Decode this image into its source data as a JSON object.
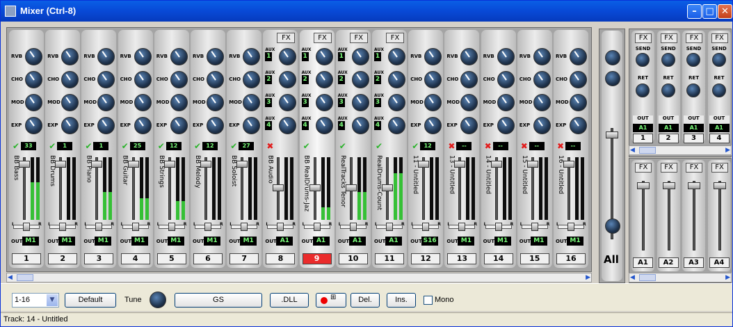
{
  "window": {
    "title": "Mixer (Ctrl-8)"
  },
  "tracks": [
    {
      "num": "1",
      "name": "BB Bass",
      "patch": "33",
      "status": "check",
      "out": "M1",
      "fx": false,
      "level": 0.6,
      "selected": false
    },
    {
      "num": "2",
      "name": "BB Drums",
      "patch": "1",
      "status": "check",
      "out": "M1",
      "fx": false,
      "level": 0,
      "selected": false
    },
    {
      "num": "3",
      "name": "BB Piano",
      "patch": "1",
      "status": "check",
      "out": "M1",
      "fx": false,
      "level": 0.45,
      "selected": false
    },
    {
      "num": "4",
      "name": "BB Guitar",
      "patch": "25",
      "status": "check",
      "out": "M1",
      "fx": false,
      "level": 0.35,
      "selected": false
    },
    {
      "num": "5",
      "name": "BB Strings",
      "patch": "12",
      "status": "check",
      "out": "M1",
      "fx": false,
      "level": 0.3,
      "selected": false
    },
    {
      "num": "6",
      "name": "BB Melody",
      "patch": "12",
      "status": "check",
      "out": "M1",
      "fx": false,
      "level": 0,
      "selected": false
    },
    {
      "num": "7",
      "name": "BB Soloist",
      "patch": "27",
      "status": "check",
      "out": "M1",
      "fx": false,
      "level": 0,
      "selected": false
    },
    {
      "num": "8",
      "name": "BB Audio",
      "patch": "",
      "status": "cross",
      "out": "A1",
      "fx": true,
      "level": 0,
      "selected": false
    },
    {
      "num": "9",
      "name": "BB RealDrums-Jaz",
      "patch": "",
      "status": "check",
      "out": "A1",
      "fx": true,
      "level": 0.2,
      "selected": true
    },
    {
      "num": "10",
      "name": "RealTracks Tenor",
      "patch": "",
      "status": "check",
      "out": "A1",
      "fx": true,
      "level": 0.45,
      "selected": false
    },
    {
      "num": "11",
      "name": "RealDrums-Count",
      "patch": "",
      "status": "check",
      "out": "A1",
      "fx": true,
      "level": 0.75,
      "selected": false
    },
    {
      "num": "12",
      "name": "11 - Untitled",
      "patch": "12",
      "status": "check",
      "out": "S16",
      "fx": false,
      "level": 0,
      "selected": false
    },
    {
      "num": "13",
      "name": "13 - Untitled",
      "patch": "--",
      "status": "cross",
      "out": "M1",
      "fx": false,
      "level": 0,
      "selected": false
    },
    {
      "num": "14",
      "name": "14 - Untitled",
      "patch": "--",
      "status": "cross",
      "out": "M1",
      "fx": false,
      "level": 0,
      "selected": false
    },
    {
      "num": "15",
      "name": "15 - Untitled",
      "patch": "--",
      "status": "cross",
      "out": "M1",
      "fx": false,
      "level": 0,
      "selected": false
    },
    {
      "num": "16",
      "name": "16 - Untitled",
      "patch": "--",
      "status": "cross",
      "out": "M1",
      "fx": false,
      "level": 0,
      "selected": false
    }
  ],
  "labels": {
    "rvb": "RVB",
    "cho": "CHO",
    "mod": "MOD",
    "exp": "EXP",
    "aux": "AUX",
    "out": "OUT",
    "fx": "FX",
    "send": "SEND",
    "ret": "RET",
    "l": "L",
    "r": "R"
  },
  "aux_numbers": [
    "1",
    "2",
    "3",
    "4"
  ],
  "master": {
    "label": "All"
  },
  "aux_sends": [
    {
      "out": "A1",
      "num": "1"
    },
    {
      "out": "A1",
      "num": "2"
    },
    {
      "out": "A1",
      "num": "3"
    },
    {
      "out": "A1",
      "num": "4"
    }
  ],
  "aux_returns": [
    "A1",
    "A2",
    "A3",
    "A4"
  ],
  "toolbar": {
    "range_value": "1-16",
    "default_label": "Default",
    "tune_label": "Tune",
    "gs_label": "GS",
    "dll_label": ".DLL",
    "del_label": "Del.",
    "ins_label": "Ins.",
    "mono_label": "Mono"
  },
  "status": {
    "text": "Track: 14 - Untitled"
  },
  "colors": {
    "selected_track": "#ea2b2b",
    "display_green": "#7cff7c",
    "meter_green": "#36c036",
    "title_bar": "#0849d6"
  }
}
